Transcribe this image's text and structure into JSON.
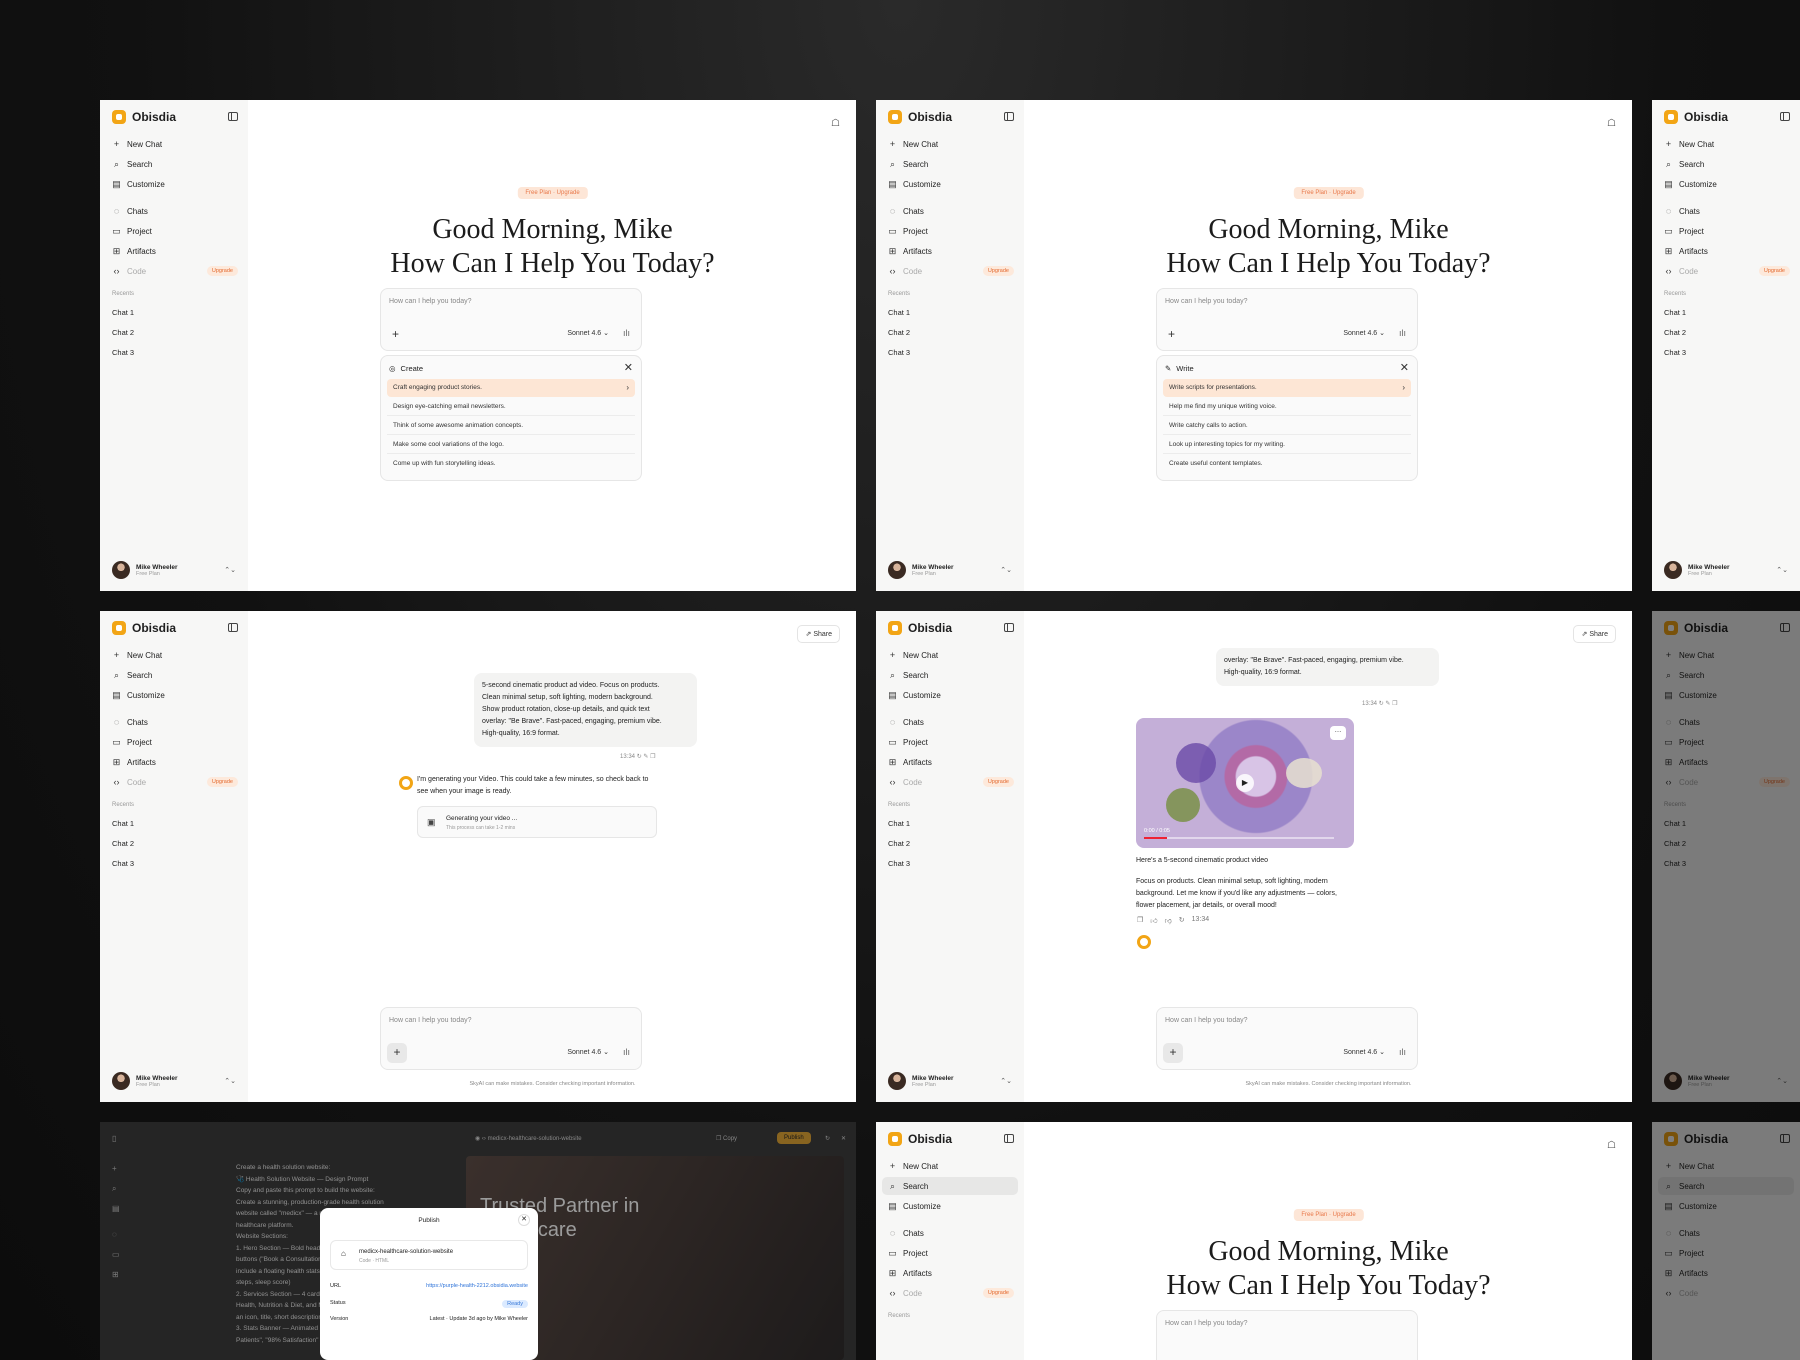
{
  "app": {
    "name": "Obisdia",
    "accent": "#f2a515",
    "upgrade_color": "#e4692e"
  },
  "nav": {
    "new_chat": "New Chat",
    "search": "Search",
    "customize": "Customize",
    "chats": "Chats",
    "project": "Project",
    "artifacts": "Artifacts",
    "code": "Code",
    "upgrade": "Upgrade",
    "recents": "Recents",
    "recent_items": [
      "Chat 1",
      "Chat 2",
      "Chat 3"
    ]
  },
  "user": {
    "name": "Mike Wheeler",
    "plan": "Free Plan"
  },
  "home": {
    "plan_pill": "Free Plan  ·  Upgrade",
    "greeting_line1": "Good Morning, Mike",
    "greeting_line2": "How Can I Help You Today?"
  },
  "composer": {
    "placeholder": "How can I help you today?",
    "model": "Sonnet 4.6"
  },
  "suggestions_create": {
    "title": "Create",
    "items": [
      "Craft engaging product stories.",
      "Design eye-catching email newsletters.",
      "Think of some awesome animation concepts.",
      "Make some cool variations of the logo.",
      "Come up with fun storytelling ideas."
    ]
  },
  "suggestions_write": {
    "title": "Write",
    "items": [
      "Write scripts for presentations.",
      "Help me find my unique writing voice.",
      "Write catchy calls to action.",
      "Look up interesting topics for my writing.",
      "Create useful content templates."
    ]
  },
  "chat": {
    "share": "Share",
    "prompt_lines": [
      "5-second cinematic product ad video. Focus on products.",
      "Clean minimal setup, soft lighting, modern background.",
      "Show product rotation, close-up details, and quick text",
      "overlay: \"Be Brave\". Fast-paced, engaging, premium vibe.",
      "High-quality, 16:9 format."
    ],
    "prompt_tail": [
      "overlay: \"Be Brave\". Fast-paced, engaging, premium vibe.",
      "High-quality, 16:9 format."
    ],
    "time": "13:34",
    "ai_reply_lines": [
      "I'm generating your Video. This could take a few minutes, so check back to",
      "see when your image is ready."
    ],
    "gen_title": "Generating your video ...",
    "gen_sub": "This process can take 1-2 mins",
    "disclaimer_left": "SkyAI can make mistakes. Consider checking important information.",
    "disclaimer_right": "SkyAI can make mistakes. Consider checking important information.",
    "video_time": "0:00 / 0:05",
    "video_caption": "Here's a 5-second cinematic product video",
    "video_desc_lines": [
      "Focus on products. Clean minimal setup, soft lighting, modern",
      "background.  Let me know if you'd like any adjustments — colors,",
      "flower placement, jar details, or overall mood!"
    ]
  },
  "publish": {
    "tab_title": "medicx-healthcare-solution-website",
    "copy": "Copy",
    "publish_btn": "Publish",
    "title": "Publish",
    "project_name": "medicx-healthcare-solution-website",
    "project_type": "Code · HTML",
    "url_label": "URL",
    "url": "https://purple-health-2212.obsidia.website",
    "status_label": "Status",
    "status": "Ready",
    "version_label": "Version",
    "version": "Latest · Update 3d ago by Mike Wheeler",
    "hero": [
      "Trusted Partner in",
      "Healthcare"
    ],
    "code_lines": [
      "Create a health solution website:",
      "🩺 Health Solution Website — Design Prompt",
      "Copy and paste this prompt to build the website:",
      "Create a stunning, production-grade health solution",
      "website called \"medicx\" — a modern wellness and",
      "healthcare platform.",
      "Website Sections:",
      "1. Hero Section — Bold headline, two CTA",
      "   buttons (\"Book a Consultation\"...)",
      "   include a floating health stats card",
      "   steps, sleep score)",
      "2. Services Section — 4 cards: General",
      "   Health, Nutrition & Diet, and More",
      "   an icon, title, short description",
      "3. Stats Banner — Animated counters",
      "   Patients\", \"98% Satisfaction\""
    ]
  }
}
